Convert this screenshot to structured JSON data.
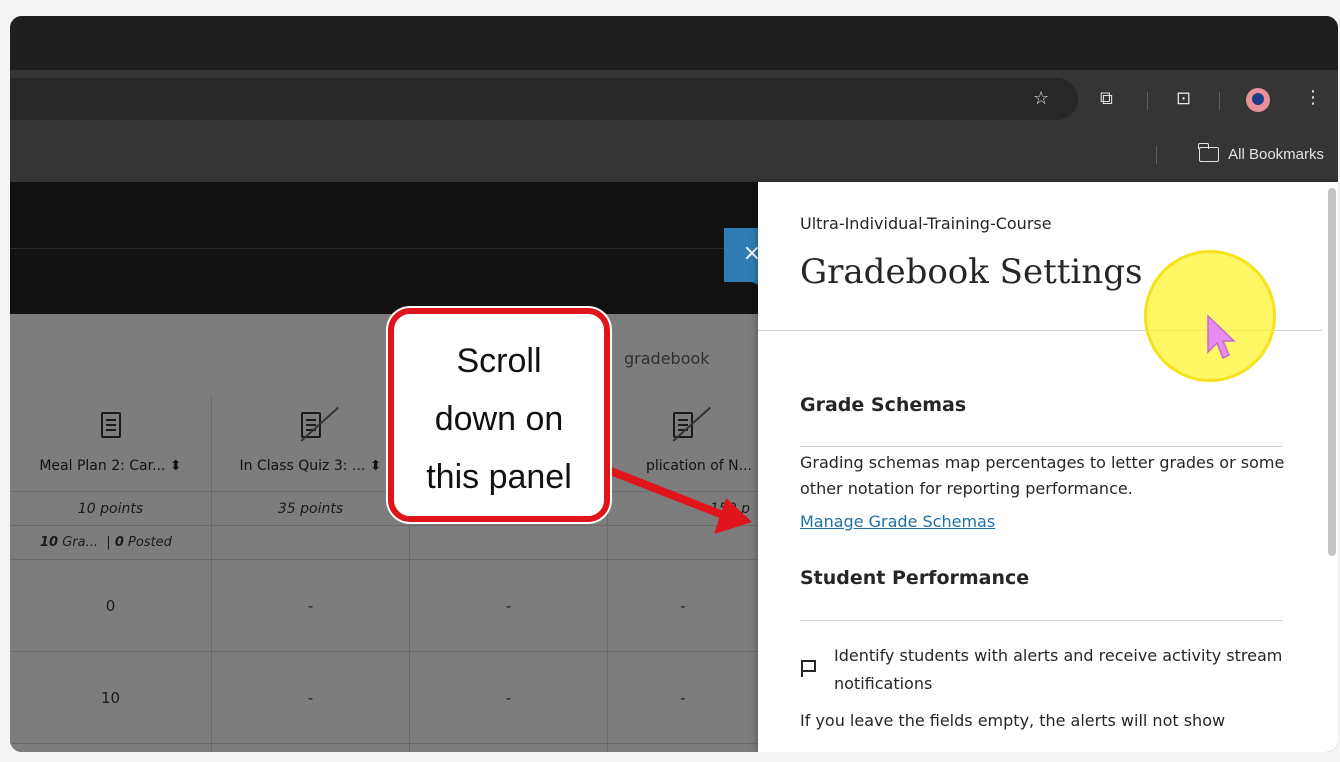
{
  "browser": {
    "bookmarks_label": "All Bookmarks",
    "icons": [
      "star-icon",
      "extensions-icon",
      "tab-search-icon",
      "profile-avatar",
      "kebab-menu-icon",
      "folder-icon"
    ]
  },
  "gradebook": {
    "search_fragment": "gradebook",
    "columns": [
      {
        "title": "Meal Plan 2: Car...",
        "points": "10 points",
        "values": [
          "0",
          "10"
        ]
      },
      {
        "title": "In Class Quiz 3: ...",
        "points": "35 points",
        "values": [
          "-",
          "-"
        ]
      },
      {
        "title": "",
        "points": "",
        "values": [
          "-",
          "-"
        ]
      },
      {
        "title": "plication of N...",
        "points": "150 p",
        "values": [
          "-",
          "-"
        ]
      }
    ],
    "posted_summary": {
      "graded_count": "10",
      "graded_label": "Gra...",
      "sep": "|",
      "posted_count": "0",
      "posted_label": "Posted"
    }
  },
  "panel": {
    "course_name": "Ultra-Individual-Training-Course",
    "title": "Gradebook Settings",
    "close_symbol": "×",
    "sections": {
      "grade_schemas": {
        "heading": "Grade Schemas",
        "description": "Grading schemas map percentages to letter grades or some other notation for reporting performance.",
        "link": "Manage Grade Schemas"
      },
      "student_performance": {
        "heading": "Student Performance",
        "alert_text": "Identify students with alerts and receive activity stream notifications",
        "footer_text": "If you leave the fields empty, the alerts will not show"
      }
    }
  },
  "annotation": {
    "callout_lines": [
      "Scroll",
      "down on",
      "this panel"
    ],
    "accent_color": "#e0151b",
    "halo_color": "#fff528"
  }
}
